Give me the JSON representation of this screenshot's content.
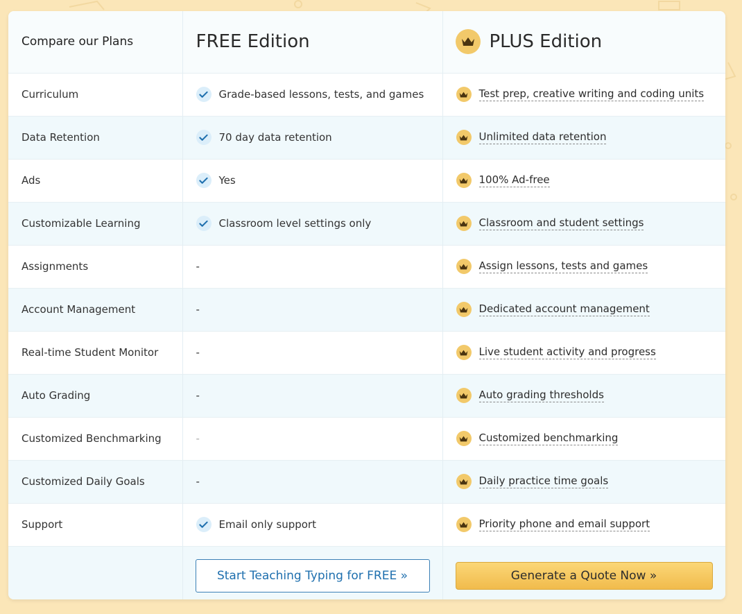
{
  "header": {
    "compare_label": "Compare our Plans",
    "free_title": "FREE Edition",
    "plus_title": "PLUS Edition"
  },
  "rows": [
    {
      "label": "Curriculum",
      "free": "Grade-based lessons, tests, and games",
      "free_check": true,
      "plus": "Test prep, creative writing and coding units"
    },
    {
      "label": "Data Retention",
      "free": "70 day data retention",
      "free_check": true,
      "plus": "Unlimited data retention"
    },
    {
      "label": "Ads",
      "free": "Yes",
      "free_check": true,
      "plus": "100% Ad-free"
    },
    {
      "label": "Customizable Learning",
      "free": "Classroom level settings only",
      "free_check": true,
      "plus": "Classroom and student settings"
    },
    {
      "label": "Assignments",
      "free": "-",
      "free_check": false,
      "plus": "Assign lessons, tests and games"
    },
    {
      "label": "Account Management",
      "free": "-",
      "free_check": false,
      "plus": "Dedicated account management"
    },
    {
      "label": "Real-time Student Monitor",
      "free": "-",
      "free_check": false,
      "plus": "Live student activity and progress"
    },
    {
      "label": "Auto Grading",
      "free": "-",
      "free_check": false,
      "plus": "Auto grading thresholds"
    },
    {
      "label": "Customized Benchmarking",
      "free": "-",
      "free_check": false,
      "plus": "Customized benchmarking"
    },
    {
      "label": "Customized Daily Goals",
      "free": "-",
      "free_check": false,
      "plus": "Daily practice time goals"
    },
    {
      "label": "Support",
      "free": "Email only support",
      "free_check": true,
      "plus": "Priority phone and email support"
    }
  ],
  "footer": {
    "free_button": "Start Teaching Typing for FREE »",
    "plus_button": "Generate a Quote Now »"
  },
  "icons": {
    "check": "check-icon",
    "crown": "crown-icon"
  },
  "colors": {
    "background": "#fbe6b8",
    "check_blue": "#1e6fae",
    "crown_gold": "#f2c96a",
    "row_alt": "#f0f9fc",
    "button_blue": "#1e6fae"
  }
}
